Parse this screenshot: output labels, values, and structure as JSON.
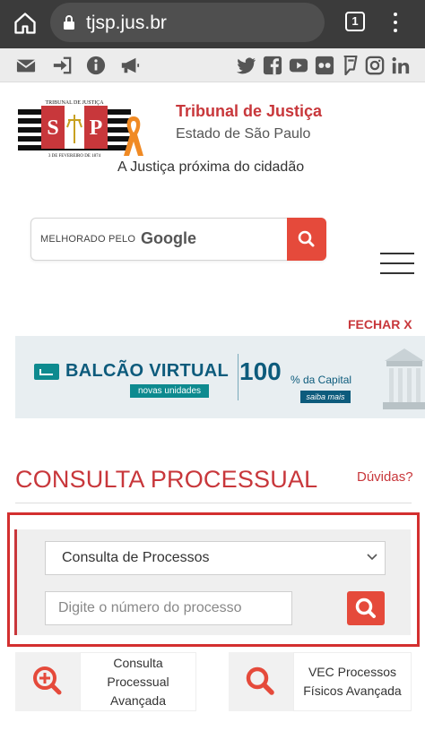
{
  "browser": {
    "url": "tjsp.jus.br",
    "tab_count": "1"
  },
  "header": {
    "title": "Tribunal de Justiça",
    "subtitle": "Estado de São Paulo",
    "tagline": "A Justiça próxima do cidadão",
    "seal_text_top": "TRIBUNAL DE JUSTIÇA",
    "seal_letters": "S P",
    "seal_text_bottom": "3 DE FEVEREIRO DE 1874"
  },
  "search": {
    "powered_by": "MELHORADO PELO",
    "brand": "Google"
  },
  "banner": {
    "close_label": "FECHAR X",
    "title": "BALCÃO VIRTUAL",
    "pill": "novas unidades",
    "big_number": "100",
    "suffix": "% da Capital",
    "link": "saiba mais"
  },
  "consulta": {
    "title": "CONSULTA PROCESSUAL",
    "help_link": "Dúvidas?",
    "select_value": "Consulta de Processos",
    "input_placeholder": "Digite o número do processo",
    "cards": [
      {
        "line1": "Consulta",
        "line2": "Processual",
        "line3": "Avançada"
      },
      {
        "line1": "VEC Processos",
        "line2": "Físicos Avançada"
      }
    ]
  },
  "colors": {
    "brand_red": "#c8373b",
    "button_red": "#e54a3b",
    "chrome_dark": "#3b3b3b",
    "banner_blue": "#0d5b7c",
    "banner_teal": "#0d8a8f"
  }
}
